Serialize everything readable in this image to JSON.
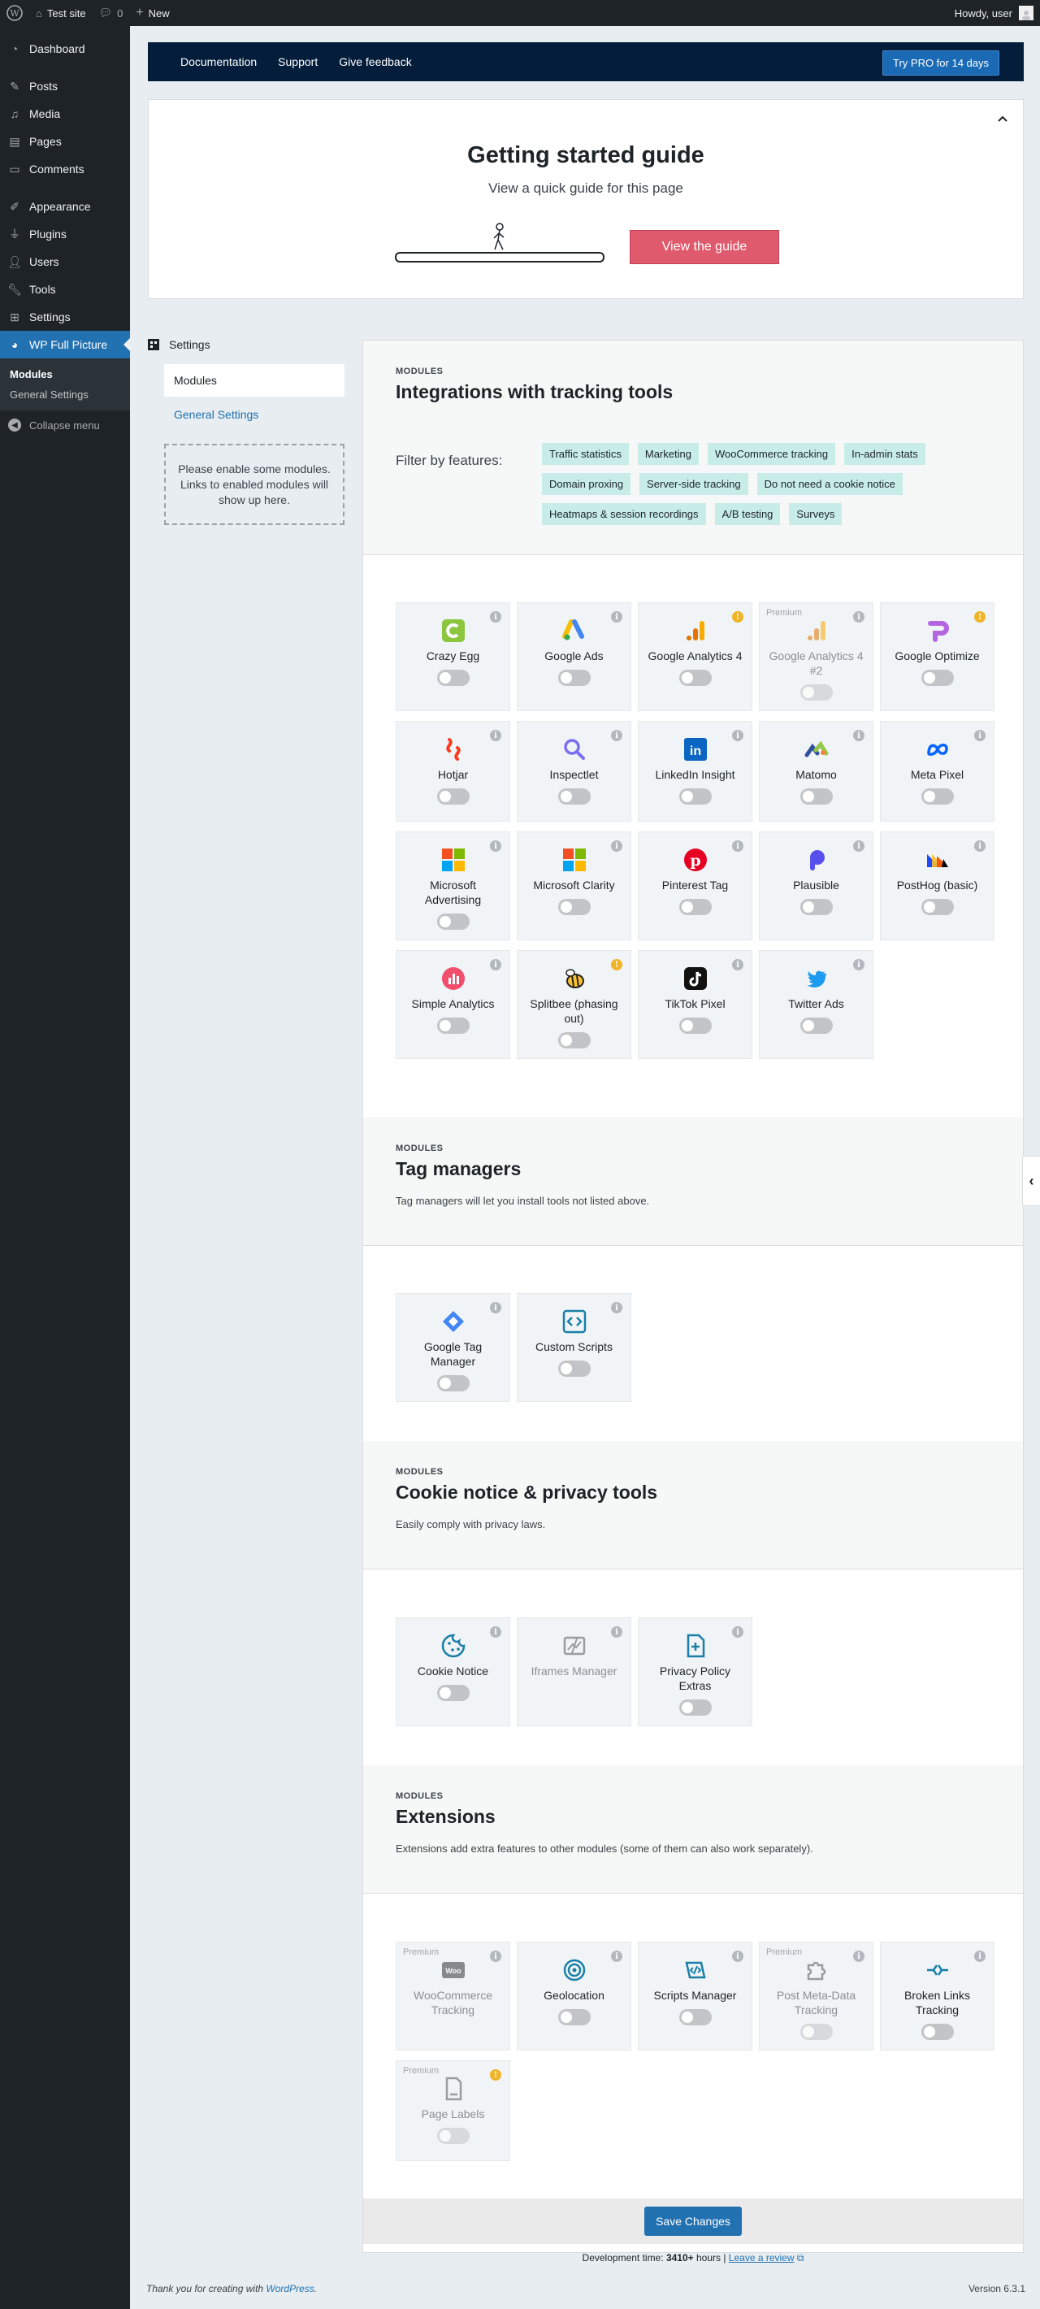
{
  "adminbar": {
    "site": "Test site",
    "comments": "0",
    "new": "New",
    "howdy": "Howdy, user"
  },
  "menu": {
    "items": [
      "Dashboard",
      "Posts",
      "Media",
      "Pages",
      "Comments",
      "Appearance",
      "Plugins",
      "Users",
      "Tools",
      "Settings",
      "WP Full Picture"
    ],
    "sub": [
      "Modules",
      "General Settings"
    ],
    "collapse": "Collapse menu"
  },
  "topnav": {
    "links": [
      "Documentation",
      "Support",
      "Give feedback"
    ],
    "trypro": "Try PRO for 14 days"
  },
  "guide": {
    "title": "Getting started guide",
    "subtitle": "View a quick guide for this page",
    "button": "View the guide"
  },
  "side": {
    "title": "Settings",
    "active": "Modules",
    "link": "General Settings",
    "note": "Please enable some modules. Links to enabled modules will show up here."
  },
  "sections": {
    "integrations": {
      "label": "MODULES",
      "title": "Integrations with tracking tools",
      "filter_title": "Filter by features:",
      "chips": [
        "Traffic statistics",
        "Marketing",
        "WooCommerce tracking",
        "In-admin stats",
        "Domain proxing",
        "Server-side tracking",
        "Do not need a cookie notice",
        "Heatmaps & session recordings",
        "A/B testing",
        "Surveys"
      ]
    },
    "tagmanagers": {
      "label": "MODULES",
      "title": "Tag managers",
      "desc": "Tag managers will let you install tools not listed above."
    },
    "cookie": {
      "label": "MODULES",
      "title": "Cookie notice & privacy tools",
      "desc": "Easily comply with privacy laws."
    },
    "extensions": {
      "label": "MODULES",
      "title": "Extensions",
      "desc": "Extensions add extra features to other modules (some of them can also work separately)."
    }
  },
  "tiles": {
    "integrations": [
      {
        "name": "Crazy Egg",
        "icon": "crazy-egg-icon"
      },
      {
        "name": "Google Ads",
        "icon": "google-ads-icon"
      },
      {
        "name": "Google Analytics 4",
        "icon": "google-analytics-icon",
        "warn": true
      },
      {
        "name": "Google Analytics 4 #2",
        "icon": "google-analytics-icon",
        "premium": "Premium",
        "dim": true
      },
      {
        "name": "Google Optimize",
        "icon": "google-optimize-icon",
        "warn": true
      },
      {
        "name": "Hotjar",
        "icon": "hotjar-icon"
      },
      {
        "name": "Inspectlet",
        "icon": "inspectlet-icon"
      },
      {
        "name": "LinkedIn Insight",
        "icon": "linkedin-icon"
      },
      {
        "name": "Matomo",
        "icon": "matomo-icon"
      },
      {
        "name": "Meta Pixel",
        "icon": "meta-icon"
      },
      {
        "name": "Microsoft Advertising",
        "icon": "microsoft-icon"
      },
      {
        "name": "Microsoft Clarity",
        "icon": "microsoft-icon"
      },
      {
        "name": "Pinterest Tag",
        "icon": "pinterest-icon"
      },
      {
        "name": "Plausible",
        "icon": "plausible-icon"
      },
      {
        "name": "PostHog (basic)",
        "icon": "posthog-icon"
      },
      {
        "name": "Simple Analytics",
        "icon": "simple-analytics-icon"
      },
      {
        "name": "Splitbee (phasing out)",
        "icon": "splitbee-icon",
        "warn": true
      },
      {
        "name": "TikTok Pixel",
        "icon": "tiktok-icon"
      },
      {
        "name": "Twitter Ads",
        "icon": "twitter-icon"
      }
    ],
    "tagmanagers": [
      {
        "name": "Google Tag Manager",
        "icon": "gtm-icon"
      },
      {
        "name": "Custom Scripts",
        "icon": "code-icon"
      }
    ],
    "cookie": [
      {
        "name": "Cookie Notice",
        "icon": "cookie-icon"
      },
      {
        "name": "Iframes Manager",
        "icon": "iframe-icon",
        "dim": true,
        "notoggle": true
      },
      {
        "name": "Privacy Policy Extras",
        "icon": "document-plus-icon"
      }
    ],
    "extensions": [
      {
        "name": "WooCommerce Tracking",
        "icon": "woo-icon",
        "premium": "Premium",
        "dim": true,
        "notoggle": true
      },
      {
        "name": "Geolocation",
        "icon": "target-icon"
      },
      {
        "name": "Scripts Manager",
        "icon": "scripts-icon"
      },
      {
        "name": "Post Meta-Data Tracking",
        "icon": "puzzle-icon",
        "premium": "Premium",
        "dim": true
      },
      {
        "name": "Broken Links Tracking",
        "icon": "broken-link-icon"
      },
      {
        "name": "Page Labels",
        "icon": "page-icon",
        "premium": "Premium",
        "dim": true,
        "warn": true
      }
    ]
  },
  "save": "Save Changes",
  "devtime": {
    "prefix": "Development time:",
    "hours": "3410+",
    "suffix": "hours |",
    "link": "Leave a review"
  },
  "footer": {
    "thanks": "Thank you for creating with",
    "wp": "WordPress",
    "version": "Version 6.3.1"
  }
}
